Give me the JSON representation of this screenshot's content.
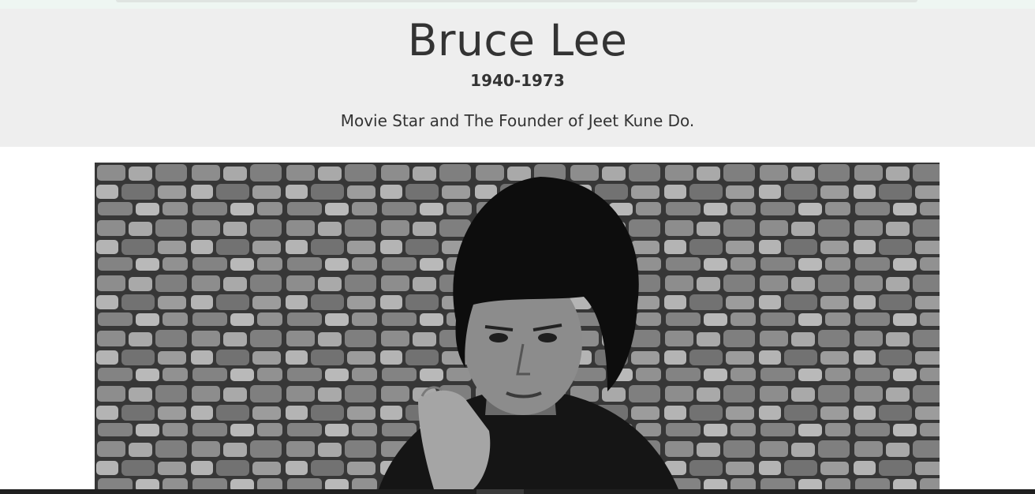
{
  "header": {
    "title": "Bruce Lee",
    "years": "1940-1973",
    "tagline": "Movie Star and The Founder of Jeet Kune Do."
  },
  "image": {
    "subject": "black-and-white portrait of Bruce Lee in front of a stone wall"
  },
  "colors": {
    "header_background": "#eeeeee",
    "text": "#333333",
    "page_background": "#ffffff"
  }
}
